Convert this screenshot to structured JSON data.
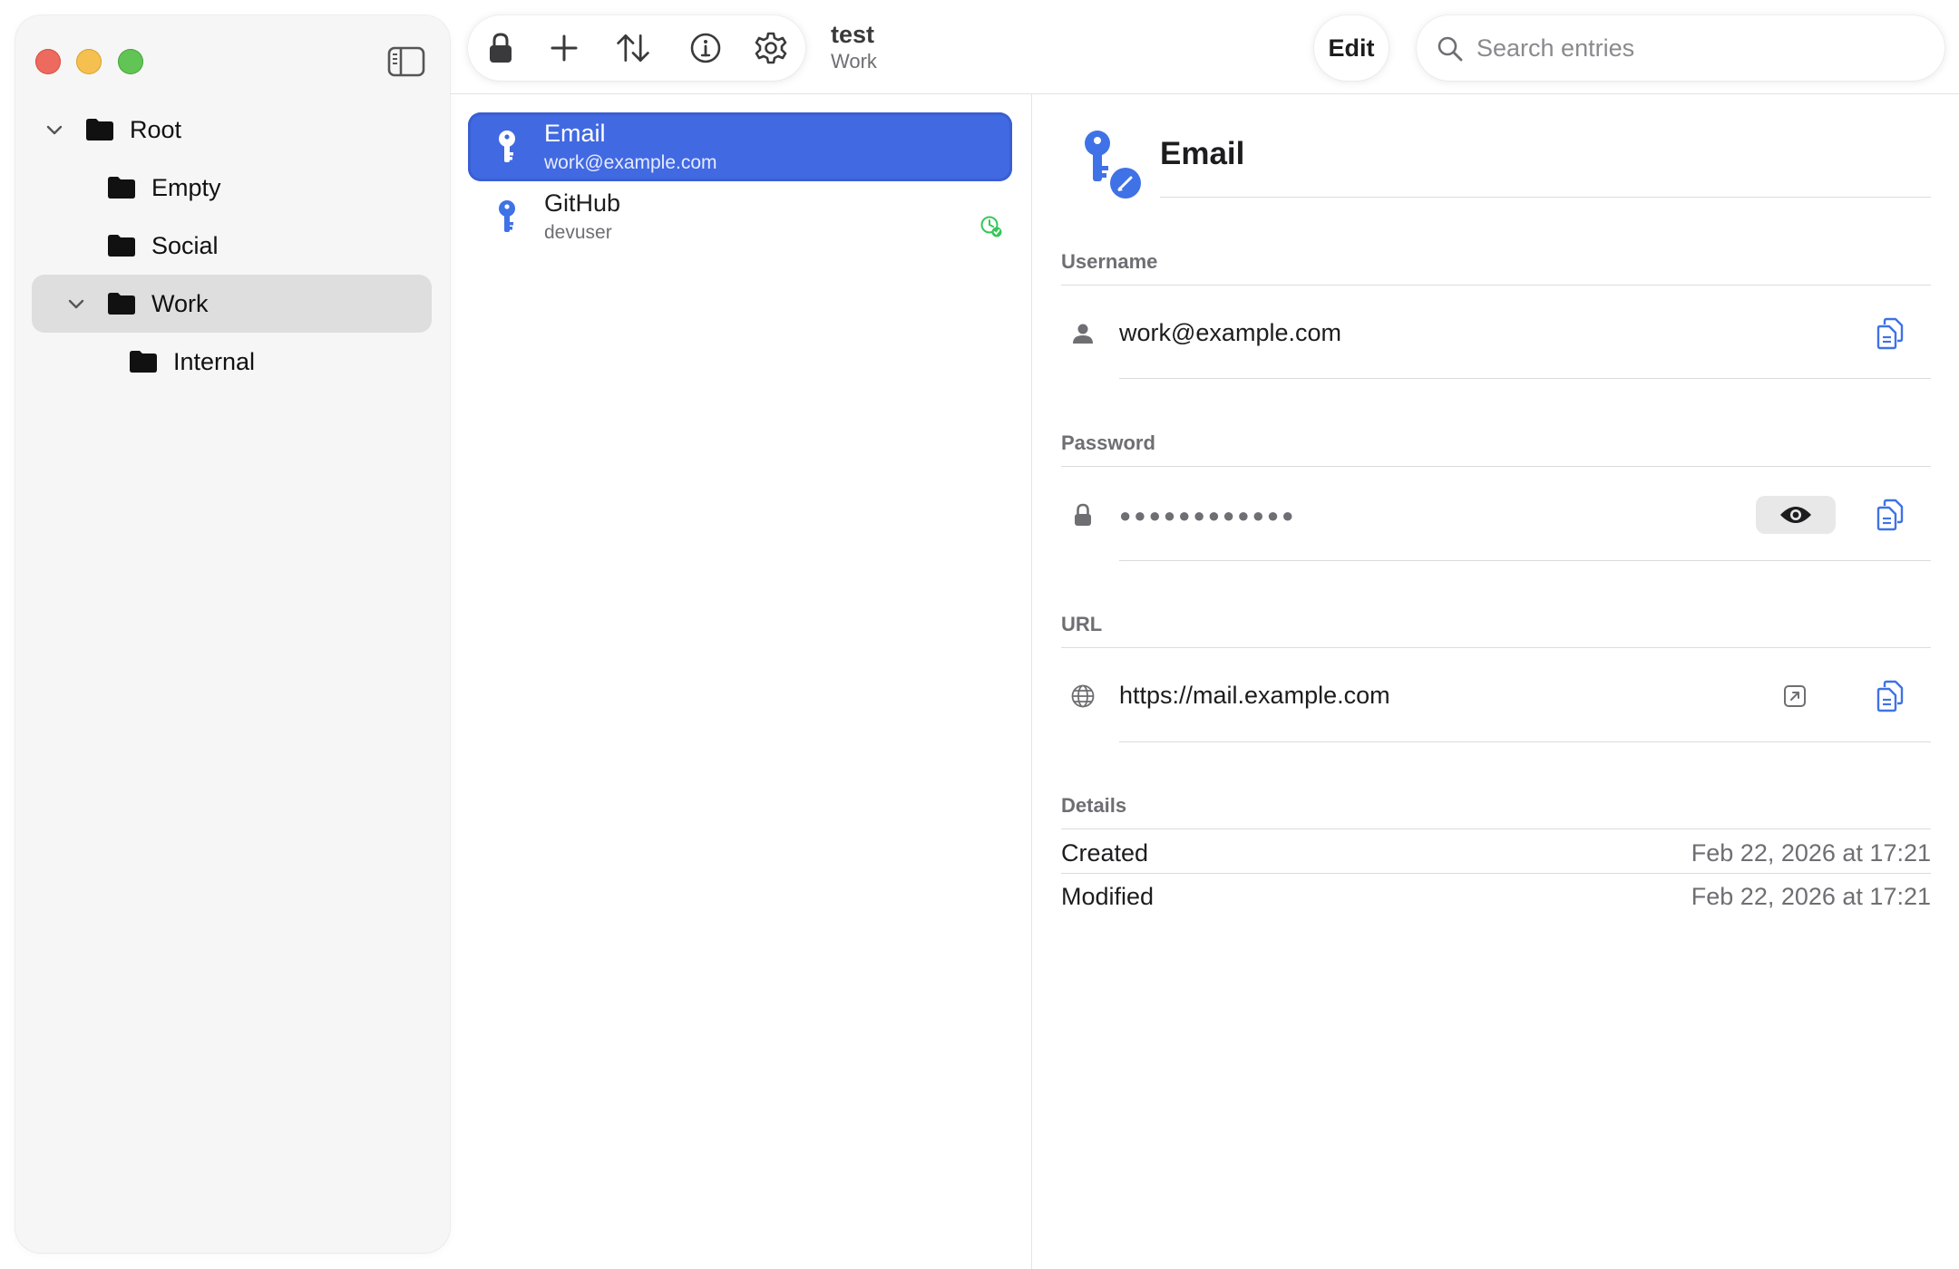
{
  "window": {
    "title": "test",
    "subtitle": "Work"
  },
  "sidebar": {
    "items": [
      {
        "label": "Root",
        "expanded": true,
        "level": 0
      },
      {
        "label": "Empty",
        "level": 1
      },
      {
        "label": "Social",
        "level": 1
      },
      {
        "label": "Work",
        "expanded": true,
        "level": 1,
        "selected": true
      },
      {
        "label": "Internal",
        "level": 2
      }
    ]
  },
  "toolbar": {
    "edit_label": "Edit",
    "icons": [
      "lock-icon",
      "plus-icon",
      "sort-icon",
      "info-icon",
      "gear-icon"
    ]
  },
  "search": {
    "placeholder": "Search entries",
    "value": ""
  },
  "entries": [
    {
      "title": "Email",
      "subtitle": "work@example.com",
      "selected": true
    },
    {
      "title": "GitHub",
      "subtitle": "devuser",
      "badge": "otp-clock-icon"
    }
  ],
  "detail": {
    "title": "Email",
    "username_label": "Username",
    "username": "work@example.com",
    "password_label": "Password",
    "password_mask": "●●●●●●●●●●●●",
    "url_label": "URL",
    "url": "https://mail.example.com",
    "details_label": "Details",
    "created_label": "Created",
    "created": "Feb 22, 2026 at 17:21",
    "modified_label": "Modified",
    "modified": "Feb 22, 2026 at 17:21"
  },
  "colors": {
    "accent": "#4169e1",
    "icon_blue": "#3f72e6",
    "otp_green": "#34c759",
    "close": "#ed6a5e",
    "minimize": "#f5c04f",
    "zoom": "#61c454"
  }
}
